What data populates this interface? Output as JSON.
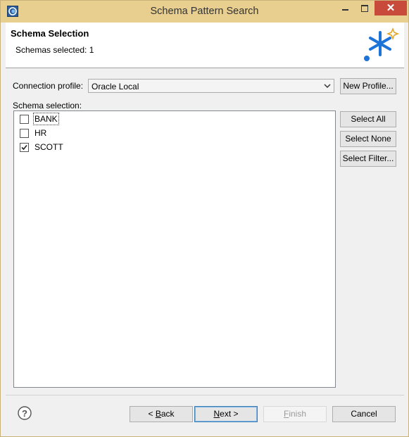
{
  "window": {
    "title": "Schema Pattern Search"
  },
  "banner": {
    "title": "Schema Selection",
    "message": "Schemas selected: 1"
  },
  "connection": {
    "label": "Connection profile:",
    "selected": "Oracle Local",
    "new_profile_label": "New Profile..."
  },
  "schema": {
    "label": "Schema selection:",
    "items": [
      {
        "label": "BANK",
        "checked": false
      },
      {
        "label": "HR",
        "checked": false
      },
      {
        "label": "SCOTT",
        "checked": true
      }
    ],
    "select_all_label": "Select All",
    "select_none_label": "Select None",
    "select_filter_label": "Select Filter..."
  },
  "footer": {
    "back_prefix": "< ",
    "back_mnemonic": "B",
    "back_rest": "ack",
    "next_mnemonic": "N",
    "next_rest": "ext >",
    "finish_mnemonic": "F",
    "finish_rest": "inish",
    "cancel_label": "Cancel"
  },
  "colors": {
    "titlebar": "#e8cf8f",
    "close": "#c74a3a",
    "logo_blue": "#1c73d8",
    "logo_gold": "#e3a321"
  },
  "icons": {
    "app": "eclipse-app-icon",
    "logo": "wizard-asterisk-logo-icon",
    "help": "help-icon"
  }
}
